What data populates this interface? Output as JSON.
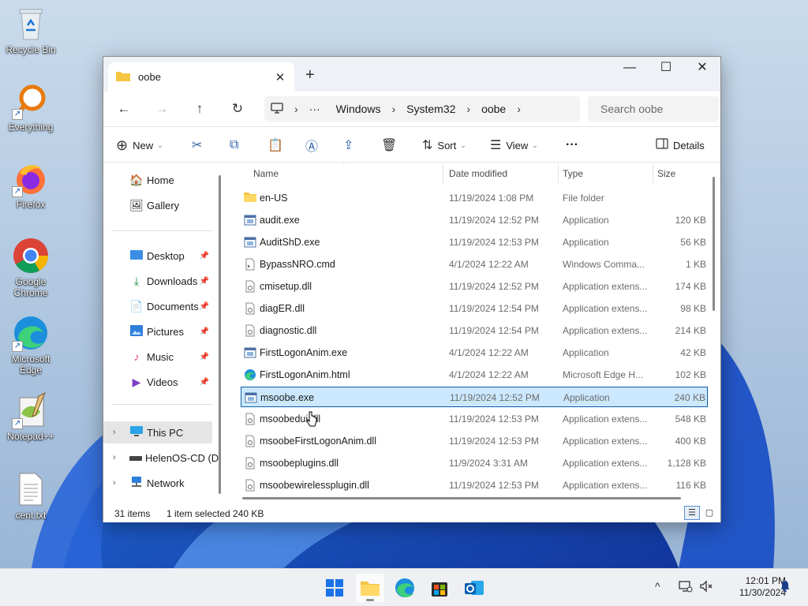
{
  "desktop": {
    "icons": [
      {
        "label": "Recycle Bin"
      },
      {
        "label": "Everything"
      },
      {
        "label": "Firefox"
      },
      {
        "label": "Google Chrome"
      },
      {
        "label": "Microsoft Edge"
      },
      {
        "label": "Notepad++"
      },
      {
        "label": "cent.txt"
      }
    ]
  },
  "window": {
    "tab_title": "oobe",
    "new_tab": "+",
    "controls": {
      "minimize": "—",
      "maximize": "☐",
      "close": "✕"
    }
  },
  "address": {
    "ellipsis": "···",
    "crumbs": [
      "Windows",
      "System32",
      "oobe"
    ],
    "search_placeholder": "Search oobe"
  },
  "commands": {
    "new": "New",
    "sort": "Sort",
    "view": "View",
    "more": "···",
    "details": "Details"
  },
  "navpane": {
    "home": "Home",
    "gallery": "Gallery",
    "desktop": "Desktop",
    "downloads": "Downloads",
    "documents": "Documents",
    "pictures": "Pictures",
    "music": "Music",
    "videos": "Videos",
    "this_pc": "This PC",
    "drive": "HelenOS-CD (D:",
    "network": "Network"
  },
  "columns": {
    "name": "Name",
    "date": "Date modified",
    "type": "Type",
    "size": "Size"
  },
  "files": [
    {
      "name": "en-US",
      "date": "11/19/2024 1:08 PM",
      "type": "File folder",
      "size": "",
      "icon": "folder"
    },
    {
      "name": "audit.exe",
      "date": "11/19/2024 12:52 PM",
      "type": "Application",
      "size": "120 KB",
      "icon": "exe"
    },
    {
      "name": "AuditShD.exe",
      "date": "11/19/2024 12:53 PM",
      "type": "Application",
      "size": "56 KB",
      "icon": "exe"
    },
    {
      "name": "BypassNRO.cmd",
      "date": "4/1/2024 12:22 AM",
      "type": "Windows Comma...",
      "size": "1 KB",
      "icon": "cmd"
    },
    {
      "name": "cmisetup.dll",
      "date": "11/19/2024 12:52 PM",
      "type": "Application extens...",
      "size": "174 KB",
      "icon": "dll"
    },
    {
      "name": "diagER.dll",
      "date": "11/19/2024 12:54 PM",
      "type": "Application extens...",
      "size": "98 KB",
      "icon": "dll"
    },
    {
      "name": "diagnostic.dll",
      "date": "11/19/2024 12:54 PM",
      "type": "Application extens...",
      "size": "214 KB",
      "icon": "dll"
    },
    {
      "name": "FirstLogonAnim.exe",
      "date": "4/1/2024 12:22 AM",
      "type": "Application",
      "size": "42 KB",
      "icon": "exe"
    },
    {
      "name": "FirstLogonAnim.html",
      "date": "4/1/2024 12:22 AM",
      "type": "Microsoft Edge H...",
      "size": "102 KB",
      "icon": "edge"
    },
    {
      "name": "msoobe.exe",
      "date": "11/19/2024 12:52 PM",
      "type": "Application",
      "size": "240 KB",
      "icon": "exe"
    },
    {
      "name": "msoobedui.dll",
      "date": "11/19/2024 12:53 PM",
      "type": "Application extens...",
      "size": "548 KB",
      "icon": "dll"
    },
    {
      "name": "msoobeFirstLogonAnim.dll",
      "date": "11/19/2024 12:53 PM",
      "type": "Application extens...",
      "size": "400 KB",
      "icon": "dll"
    },
    {
      "name": "msoobeplugins.dll",
      "date": "11/9/2024 3:31 AM",
      "type": "Application extens...",
      "size": "1,128 KB",
      "icon": "dll"
    },
    {
      "name": "msoobewirelessplugin.dll",
      "date": "11/19/2024 12:53 PM",
      "type": "Application extens...",
      "size": "116 KB",
      "icon": "dll"
    }
  ],
  "status": {
    "items": "31 items",
    "selected": "1 item selected",
    "size": "240 KB"
  },
  "taskbar": {
    "time": "12:01 PM",
    "date": "11/30/2024",
    "tray_chevron": "^"
  },
  "colors": {
    "accent": "#0b5ca8",
    "selection": "#cce8ff",
    "folder": "#f5c542"
  }
}
